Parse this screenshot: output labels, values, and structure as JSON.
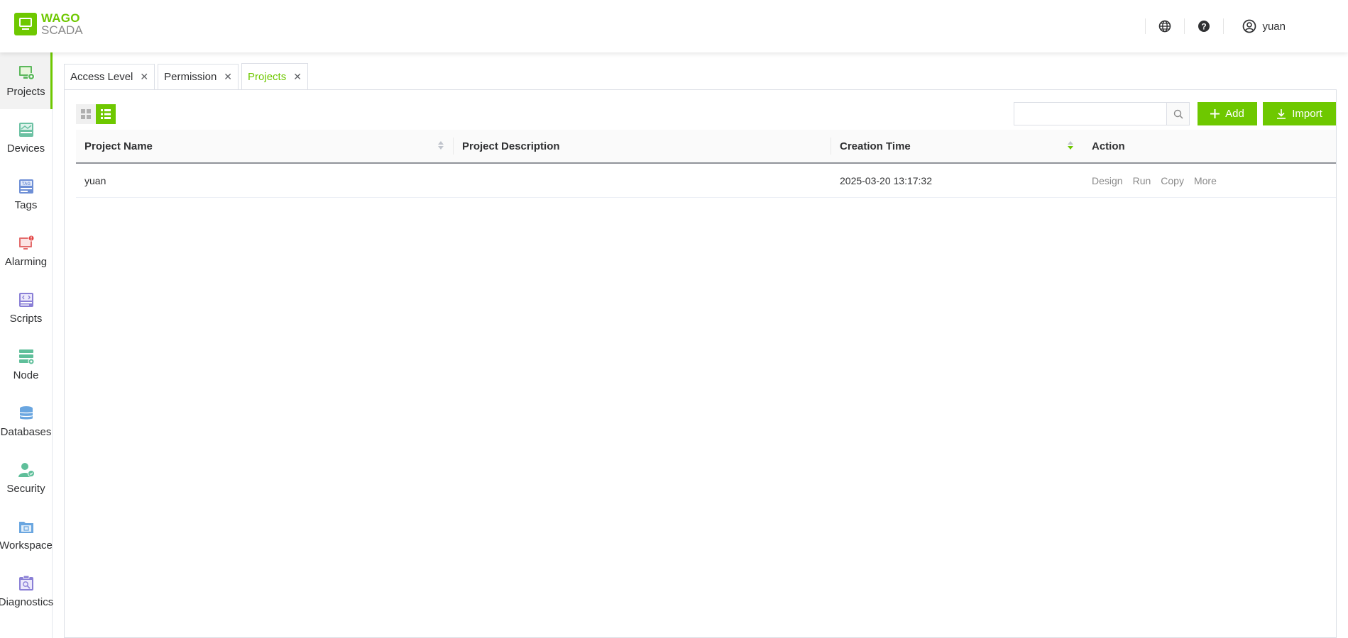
{
  "app": {
    "logo_top": "WAGO",
    "logo_bottom": "SCADA"
  },
  "header": {
    "user_name": "yuan",
    "icons": [
      "globe-icon",
      "help-icon",
      "user-circle-icon"
    ]
  },
  "sidebar": {
    "items": [
      {
        "label": "Projects",
        "icon": "projects-icon",
        "active": true
      },
      {
        "label": "Devices",
        "icon": "devices-icon"
      },
      {
        "label": "Tags",
        "icon": "tags-icon"
      },
      {
        "label": "Alarming",
        "icon": "alarming-icon"
      },
      {
        "label": "Scripts",
        "icon": "scripts-icon"
      },
      {
        "label": "Node",
        "icon": "node-icon"
      },
      {
        "label": "Databases",
        "icon": "databases-icon"
      },
      {
        "label": "Security",
        "icon": "security-icon"
      },
      {
        "label": "Workspace",
        "icon": "workspace-icon"
      },
      {
        "label": "Diagnostics",
        "icon": "diagnostics-icon"
      }
    ]
  },
  "tabs": [
    {
      "label": "Access Level"
    },
    {
      "label": "Permission"
    },
    {
      "label": "Projects",
      "active": true
    }
  ],
  "toolbar": {
    "search_value": "",
    "add_label": "Add",
    "import_label": "Import"
  },
  "table": {
    "columns": [
      "Project Name",
      "Project Description",
      "Creation Time",
      "Action"
    ],
    "rows": [
      {
        "name": "yuan",
        "description": "",
        "created": "2025-03-20 13:17:32",
        "actions": [
          "Design",
          "Run",
          "Copy",
          "More"
        ]
      }
    ]
  },
  "colors": {
    "accent": "#6ec800",
    "text": "#303133",
    "muted": "#8a8a8a"
  }
}
